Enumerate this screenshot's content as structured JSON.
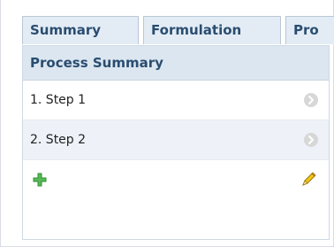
{
  "tabs": [
    {
      "label": "Summary"
    },
    {
      "label": "Formulation"
    },
    {
      "label": "Pro"
    }
  ],
  "panel": {
    "title": "Process Summary",
    "steps": [
      {
        "label": "1. Step 1"
      },
      {
        "label": "2. Step 2"
      }
    ]
  },
  "icons": {
    "row_action": "chevron-right-icon",
    "add": "plus-icon",
    "edit": "pencil-icon"
  },
  "colors": {
    "tab_bg": "#e3ecf5",
    "tab_text": "#2a4d70",
    "header_bg": "#dbe6f0",
    "alt_row_bg": "#eef2f8",
    "add_green": "#4caf50",
    "pencil_yellow": "#f0c419"
  }
}
